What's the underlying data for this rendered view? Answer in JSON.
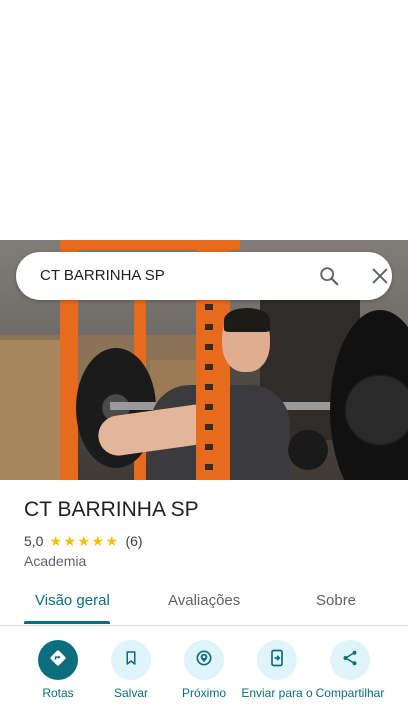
{
  "search": {
    "query": "CT BARRINHA SP"
  },
  "place": {
    "name": "CT BARRINHA SP",
    "rating": "5,0",
    "stars": 5,
    "review_count": "(6)",
    "category": "Academia"
  },
  "tabs": [
    {
      "label": "Visão geral",
      "active": true
    },
    {
      "label": "Avaliações",
      "active": false
    },
    {
      "label": "Sobre",
      "active": false
    }
  ],
  "actions": [
    {
      "label": "Rotas",
      "icon": "directions-icon",
      "primary": true
    },
    {
      "label": "Salvar",
      "icon": "bookmark-icon",
      "primary": false
    },
    {
      "label": "Próximo",
      "icon": "nearby-icon",
      "primary": false
    },
    {
      "label": "Enviar para o",
      "icon": "send-to-phone-icon",
      "primary": false
    },
    {
      "label": "Compartilhar",
      "icon": "share-icon",
      "primary": false
    }
  ],
  "colors": {
    "accent": "#0b6e7e",
    "action_bg": "#dff4fb",
    "star": "#fbbc04"
  }
}
